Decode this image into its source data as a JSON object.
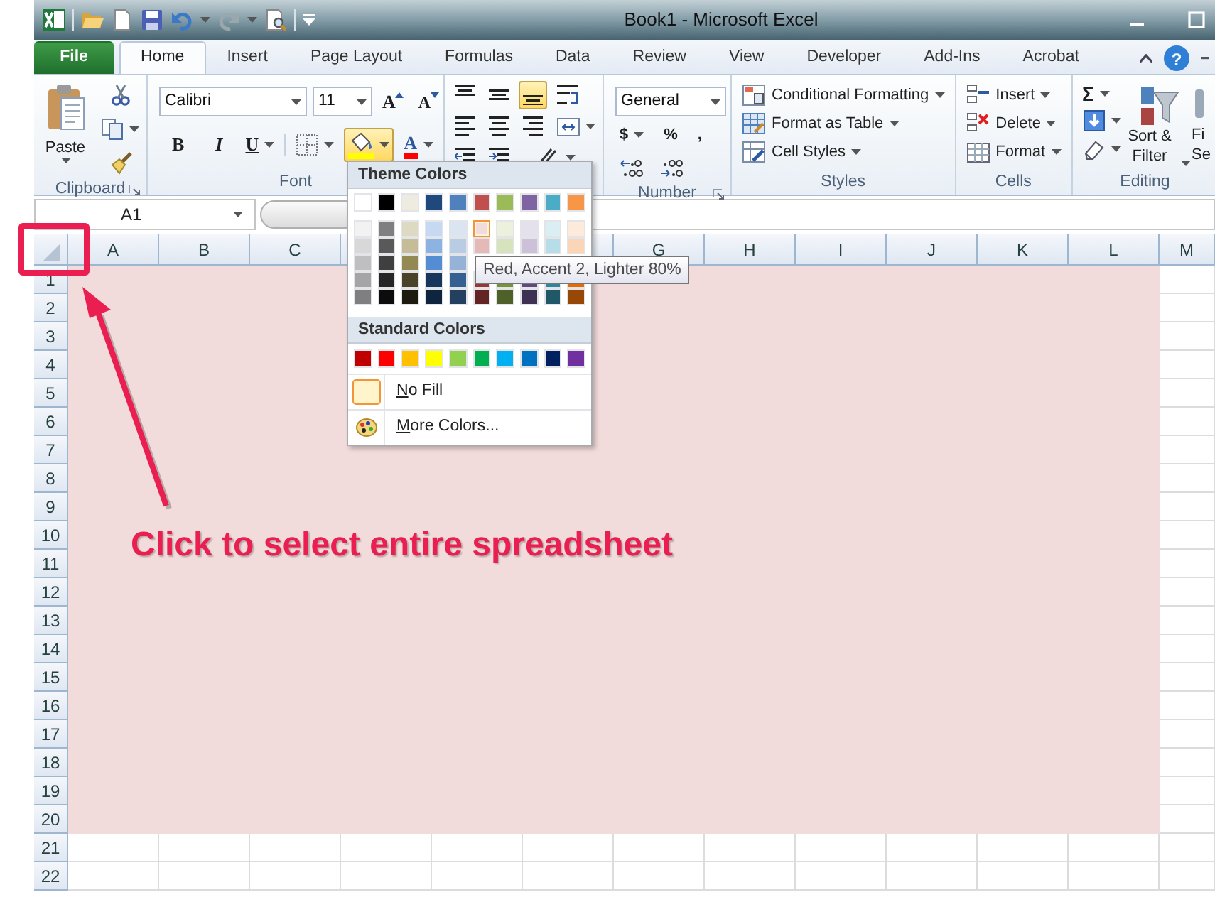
{
  "window": {
    "title": "Book1  -  Microsoft Excel"
  },
  "ribbon_tabs": [
    {
      "label": "File",
      "kind": "file",
      "selected": false
    },
    {
      "label": "Home",
      "kind": "tab",
      "selected": true
    },
    {
      "label": "Insert",
      "kind": "tab",
      "selected": false
    },
    {
      "label": "Page Layout",
      "kind": "tab",
      "selected": false
    },
    {
      "label": "Formulas",
      "kind": "tab",
      "selected": false
    },
    {
      "label": "Data",
      "kind": "tab",
      "selected": false
    },
    {
      "label": "Review",
      "kind": "tab",
      "selected": false
    },
    {
      "label": "View",
      "kind": "tab",
      "selected": false
    },
    {
      "label": "Developer",
      "kind": "tab",
      "selected": false
    },
    {
      "label": "Add-Ins",
      "kind": "tab",
      "selected": false
    },
    {
      "label": "Acrobat",
      "kind": "tab",
      "selected": false
    }
  ],
  "help": "?",
  "ribbon": {
    "clipboard": {
      "label": "Clipboard",
      "paste": "Paste"
    },
    "font": {
      "label": "Font",
      "font_name": "Calibri",
      "font_size": "11",
      "grow": "A",
      "shrink": "A",
      "bold": "B",
      "italic": "I",
      "underline": "U",
      "font_color": "A",
      "fill_expanded": true
    },
    "alignment": {
      "vertical_align": [
        {
          "selected": false
        },
        {
          "selected": false
        },
        {
          "selected": true
        }
      ]
    },
    "number": {
      "label": "Number",
      "format": "General",
      "currency": "$",
      "percent": "%",
      "comma": ","
    },
    "styles": {
      "label": "Styles",
      "items": [
        "Conditional Formatting",
        "Format as Table",
        "Cell Styles"
      ]
    },
    "cells": {
      "label": "Cells",
      "items": [
        "Insert",
        "Delete",
        "Format"
      ]
    },
    "editing": {
      "label": "Editing",
      "sum": "Σ",
      "sort_filter": "Sort & Filter",
      "find_select": [
        "Fi",
        "Se"
      ]
    }
  },
  "formula_bar": {
    "name_box": "A1"
  },
  "sheet": {
    "color": "#f2dcdb",
    "columns": [
      {
        "label": "A",
        "kind": "full"
      },
      {
        "label": "B",
        "kind": "full"
      },
      {
        "label": "C",
        "kind": "full"
      },
      {
        "kind": "full"
      },
      {
        "kind": "covered"
      },
      {
        "kind": "full"
      },
      {
        "label": "G",
        "kind": "full"
      },
      {
        "label": "H",
        "kind": "full"
      },
      {
        "label": "I",
        "kind": "full"
      },
      {
        "label": "J",
        "kind": "full"
      },
      {
        "label": "K",
        "kind": "full"
      },
      {
        "label": "L",
        "kind": "full"
      },
      {
        "label": "M",
        "kind": "partial"
      }
    ],
    "rows": [
      {
        "label": "1",
        "filled": true
      },
      {
        "label": "2",
        "filled": true
      },
      {
        "label": "3",
        "filled": true
      },
      {
        "label": "4",
        "filled": true
      },
      {
        "label": "5",
        "filled": true
      },
      {
        "label": "6",
        "filled": true
      },
      {
        "label": "7",
        "filled": true
      },
      {
        "label": "8",
        "filled": true
      },
      {
        "label": "9",
        "filled": true
      },
      {
        "label": "10",
        "filled": true
      },
      {
        "label": "11",
        "filled": true
      },
      {
        "label": "12",
        "filled": true
      },
      {
        "label": "13",
        "filled": true
      },
      {
        "label": "14",
        "filled": true
      },
      {
        "label": "15",
        "filled": true
      },
      {
        "label": "16",
        "filled": true
      },
      {
        "label": "17",
        "filled": true
      },
      {
        "label": "18",
        "filled": true
      },
      {
        "label": "19",
        "filled": true
      },
      {
        "label": "20",
        "filled": true
      },
      {
        "label": "21",
        "filled": false
      },
      {
        "label": "22",
        "filled": false
      }
    ]
  },
  "fill_menu": {
    "theme_header": "Theme Colors",
    "theme_colors": [
      {
        "color": "#ffffff"
      },
      {
        "color": "#000000"
      },
      {
        "color": "#eeece1"
      },
      {
        "color": "#1f497d"
      },
      {
        "color": "#4f81bd"
      },
      {
        "color": "#c0504d"
      },
      {
        "color": "#9bbb59"
      },
      {
        "color": "#8064a2"
      },
      {
        "color": "#4bacc6"
      },
      {
        "color": "#f79646"
      }
    ],
    "theme_shades": [
      [
        {
          "color": "#f2f2f2",
          "selected": false
        },
        {
          "color": "#7f7f7f",
          "selected": false
        },
        {
          "color": "#ddd9c3",
          "selected": false
        },
        {
          "color": "#c6d9f0",
          "selected": false
        },
        {
          "color": "#dbe5f1",
          "selected": false
        },
        {
          "color": "#f2dcdb",
          "selected": true
        },
        {
          "color": "#ebf1dd",
          "selected": false
        },
        {
          "color": "#e5e0ec",
          "selected": false
        },
        {
          "color": "#dbeef3",
          "selected": false
        },
        {
          "color": "#fdeada",
          "selected": false
        }
      ],
      [
        {
          "color": "#d8d8d8",
          "selected": false
        },
        {
          "color": "#595959",
          "selected": false
        },
        {
          "color": "#c4bd97",
          "selected": false
        },
        {
          "color": "#8db3e2",
          "selected": false
        },
        {
          "color": "#b8cce4",
          "selected": false
        },
        {
          "color": "#e5b9b7",
          "selected": false
        },
        {
          "color": "#d7e3bc",
          "selected": false
        },
        {
          "color": "#ccc1d9",
          "selected": false
        },
        {
          "color": "#b7dde8",
          "selected": false
        },
        {
          "color": "#fbd5b5",
          "selected": false
        }
      ],
      [
        {
          "color": "#bfbfbf",
          "selected": false
        },
        {
          "color": "#3f3f3f",
          "selected": false
        },
        {
          "color": "#938953",
          "selected": false
        },
        {
          "color": "#548dd4",
          "selected": false
        },
        {
          "color": "#95b3d7",
          "selected": false
        }
      ],
      [
        {
          "color": "#a5a5a5",
          "selected": false
        },
        {
          "color": "#262626",
          "selected": false
        },
        {
          "color": "#494429",
          "selected": false
        },
        {
          "color": "#17365d",
          "selected": false
        },
        {
          "color": "#366092",
          "selected": false
        },
        {
          "color": "#953734",
          "selected": false
        },
        {
          "color": "#76923c",
          "selected": false
        },
        {
          "color": "#5f497a",
          "selected": false
        },
        {
          "color": "#31859b",
          "selected": false
        },
        {
          "color": "#e36c09",
          "selected": false
        }
      ],
      [
        {
          "color": "#7f7f7f",
          "selected": false
        },
        {
          "color": "#0c0c0c",
          "selected": false
        },
        {
          "color": "#1d1b10",
          "selected": false
        },
        {
          "color": "#0f243e",
          "selected": false
        },
        {
          "color": "#244061",
          "selected": false
        },
        {
          "color": "#632423",
          "selected": false
        },
        {
          "color": "#4f6128",
          "selected": false
        },
        {
          "color": "#3f3151",
          "selected": false
        },
        {
          "color": "#205867",
          "selected": false
        },
        {
          "color": "#974806",
          "selected": false
        }
      ]
    ],
    "standard_header": "Standard Colors",
    "standard_colors": [
      {
        "color": "#c00000"
      },
      {
        "color": "#ff0000"
      },
      {
        "color": "#ffc000"
      },
      {
        "color": "#ffff00"
      },
      {
        "color": "#92d050"
      },
      {
        "color": "#00b050"
      },
      {
        "color": "#00b0f0"
      },
      {
        "color": "#0070c0"
      },
      {
        "color": "#002060"
      },
      {
        "color": "#7030a0"
      }
    ],
    "no_fill": {
      "access_key": "N",
      "rest": "o Fill"
    },
    "more_colors": {
      "access_key": "M",
      "rest": "ore Colors..."
    }
  },
  "tooltip": "Red, Accent 2, Lighter 80%",
  "annotation": {
    "text": "Click to select entire spreadsheet"
  }
}
